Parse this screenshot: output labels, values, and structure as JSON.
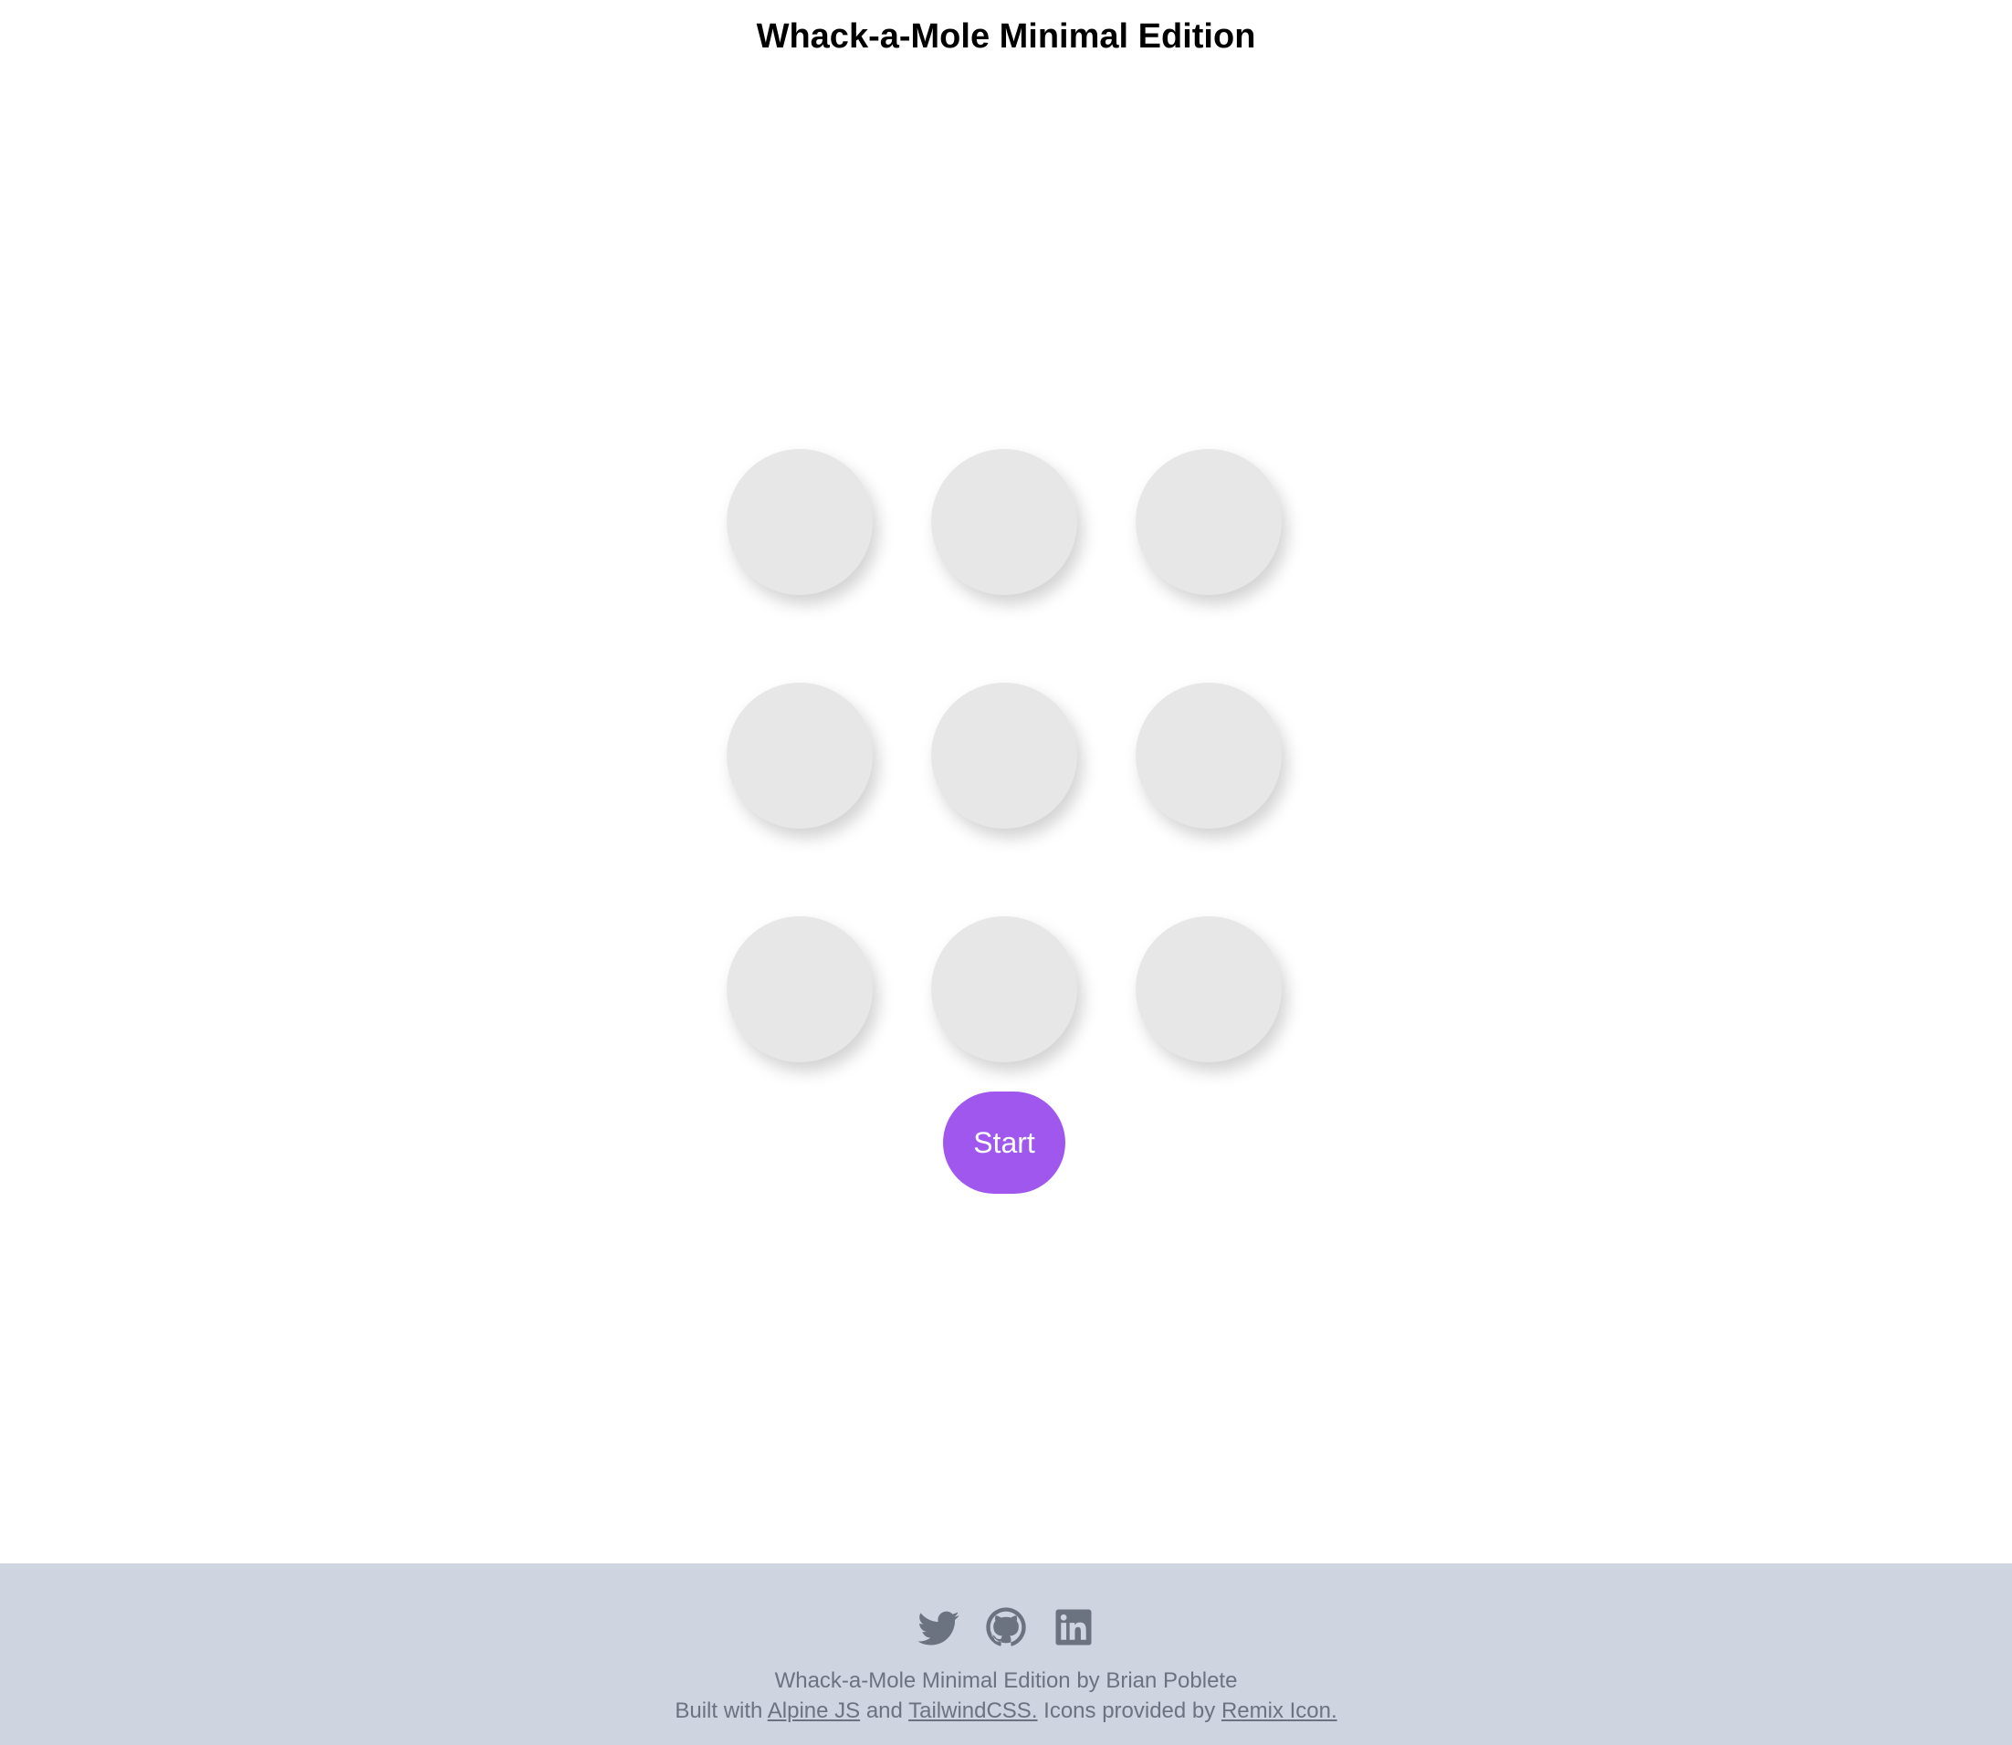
{
  "header": {
    "title": "Whack-a-Mole Minimal Edition"
  },
  "board": {
    "rows": 3,
    "columns": 3,
    "hole_color": "#e7e7e7"
  },
  "controls": {
    "start_label": "Start",
    "start_color": "#9f57ee"
  },
  "footer": {
    "background": "#cfd5e0",
    "social_icons": [
      "twitter-icon",
      "github-icon",
      "linkedin-icon"
    ],
    "credit_line": "Whack-a-Mole Minimal Edition by Brian Poblete",
    "built_with_prefix": "Built with",
    "alpine_link": "Alpine JS",
    "and_text": "and",
    "tailwind_link": "TailwindCSS.",
    "icons_text": "Icons provided by",
    "remix_link": "Remix Icon."
  }
}
